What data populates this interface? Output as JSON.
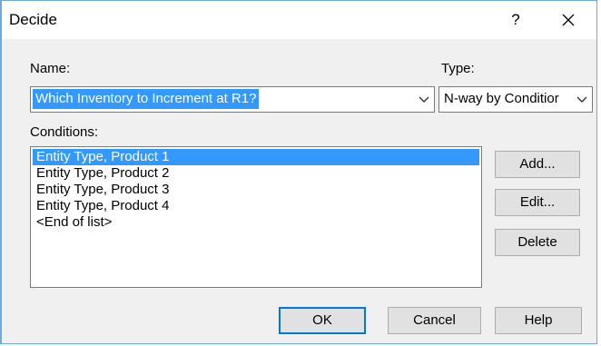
{
  "dialog": {
    "title": "Decide",
    "help_glyph": "?",
    "close_icon": "close-icon"
  },
  "name_field": {
    "label": "Name:",
    "value": "Which Inventory to Increment at R1?"
  },
  "type_field": {
    "label": "Type:",
    "value": "N-way by Conditior"
  },
  "conditions": {
    "label": "Conditions:",
    "items": [
      "Entity Type, Product 1",
      "Entity Type, Product 2",
      "Entity Type, Product 3",
      "Entity Type, Product 4",
      "<End of list>"
    ],
    "selected_index": 0
  },
  "side_buttons": {
    "add": "Add...",
    "edit": "Edit...",
    "delete": "Delete"
  },
  "footer_buttons": {
    "ok": "OK",
    "cancel": "Cancel",
    "help": "Help"
  },
  "colors": {
    "selection": "#3399ff",
    "dialog_bg": "#f0f0f0",
    "default_button_border": "#0078d7"
  }
}
